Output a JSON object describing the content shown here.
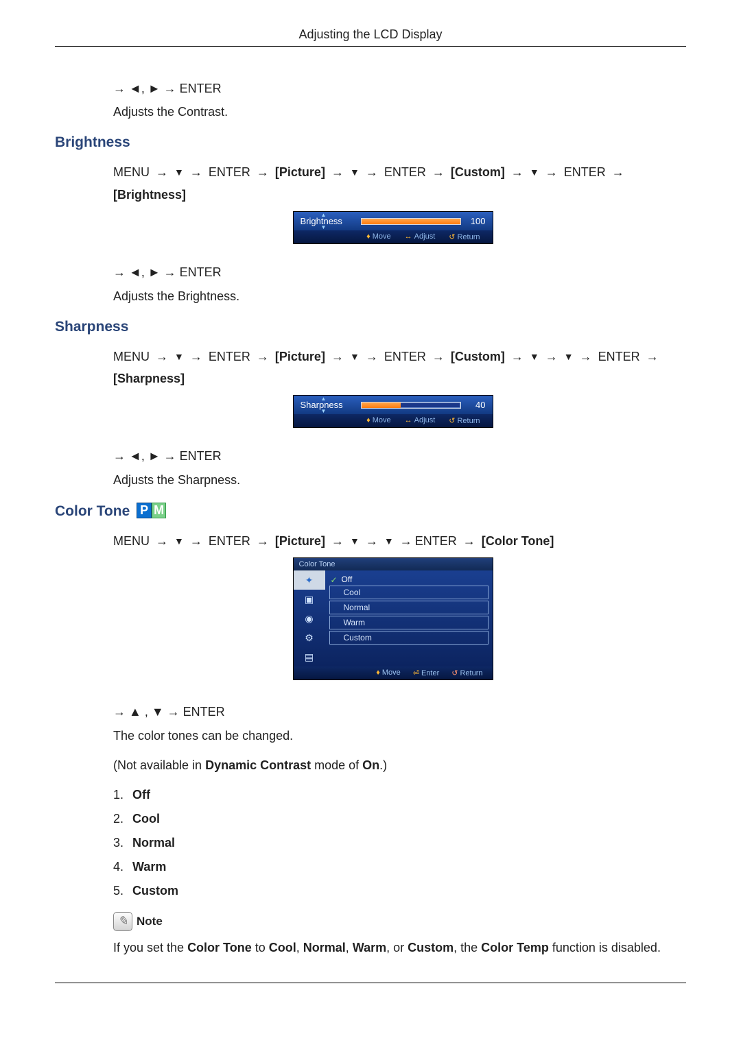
{
  "header": {
    "title": "Adjusting the LCD Display"
  },
  "contrast": {
    "nav_after": "→ ◄, ► → ENTER",
    "desc": "Adjusts the Contrast."
  },
  "brightness": {
    "title": "Brightness",
    "path_line": "MENU → ▼ → ENTER → [Picture] → ▼ → ENTER → [Custom] → ▼ → ENTER → [Brightness]",
    "osd": {
      "label": "Brightness",
      "value": "100",
      "fill_pct": 100,
      "hint_move": "Move",
      "hint_adjust": "Adjust",
      "hint_return": "Return"
    },
    "nav_after": "→ ◄, ► → ENTER",
    "desc": "Adjusts the Brightness."
  },
  "sharpness": {
    "title": "Sharpness",
    "path_line": "MENU → ▼ → ENTER → [Picture] → ▼ → ENTER → [Custom] → ▼ → ▼ → ENTER → [Sharpness]",
    "osd": {
      "label": "Sharpness",
      "value": "40",
      "fill_pct": 40,
      "hint_move": "Move",
      "hint_adjust": "Adjust",
      "hint_return": "Return"
    },
    "nav_after": "→ ◄, ► → ENTER",
    "desc": "Adjusts the Sharpness."
  },
  "colortone": {
    "title": "Color Tone",
    "badge_p": "P",
    "badge_m": "M",
    "path_line": "MENU → ▼ → ENTER → [Picture] → ▼ → ▼ →ENTER → [Color Tone]",
    "osd": {
      "title": "Color Tone",
      "options": [
        "Off",
        "Cool",
        "Normal",
        "Warm",
        "Custom"
      ],
      "selected_index": 0,
      "hint_move": "Move",
      "hint_enter": "Enter",
      "hint_return": "Return"
    },
    "nav_after": "→ ▲ , ▼ → ENTER",
    "desc1": "The color tones can be changed.",
    "desc2_pre": "(Not available in ",
    "desc2_bold1": "Dynamic Contrast",
    "desc2_mid": " mode of ",
    "desc2_bold2": "On",
    "desc2_end": ".)",
    "list": [
      "Off",
      "Cool",
      "Normal",
      "Warm",
      "Custom"
    ],
    "note_label": "Note",
    "note_text_pre": "If you set the ",
    "note_b1": "Color Tone",
    "note_mid1": " to ",
    "note_b2": "Cool",
    "note_c1": ", ",
    "note_b3": "Normal",
    "note_c2": ", ",
    "note_b4": "Warm",
    "note_c3": ", or ",
    "note_b5": "Custom",
    "note_mid2": ", the ",
    "note_b6": "Color Temp",
    "note_end": " function is disabled."
  }
}
